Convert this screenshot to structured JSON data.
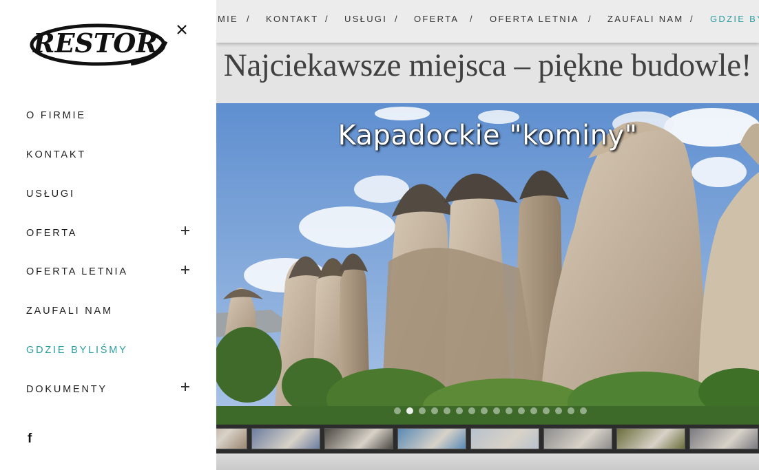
{
  "topnav": {
    "items": [
      "MIE",
      "KONTAKT",
      "USŁUGI",
      "OFERTA",
      "OFERTA LETNIA",
      "ZAUFALI NAM",
      "GDZIE BY"
    ],
    "separator": "/",
    "active_index": 6
  },
  "headline": "Najciekawsze miejsca – piękne budowle!",
  "slider": {
    "caption": "Kapadockie \"kominy\"",
    "dots_total": 16,
    "active_dot": 1
  },
  "thumbnails": [
    {
      "name": "partial",
      "color": "#9a8570"
    },
    {
      "name": "snow-mountains",
      "color": "#6c7da0"
    },
    {
      "name": "crowd",
      "color": "#4d4a44"
    },
    {
      "name": "people-sea",
      "color": "#5a8ab5"
    },
    {
      "name": "snow-people",
      "color": "#b7c1cc"
    },
    {
      "name": "colonnade",
      "color": "#8c8c8c"
    },
    {
      "name": "mural",
      "color": "#6b6e3c"
    },
    {
      "name": "street",
      "color": "#7a7a80"
    }
  ],
  "drawer": {
    "logo_text": "RESTOR",
    "close_icon": "close-icon",
    "items": [
      {
        "label": "O FIRMIE",
        "has_submenu": false,
        "active": false
      },
      {
        "label": "KONTAKT",
        "has_submenu": false,
        "active": false
      },
      {
        "label": "USŁUGI",
        "has_submenu": false,
        "active": false
      },
      {
        "label": "OFERTA",
        "has_submenu": true,
        "active": false
      },
      {
        "label": "OFERTA LETNIA",
        "has_submenu": true,
        "active": false
      },
      {
        "label": "ZAUFALI NAM",
        "has_submenu": false,
        "active": false
      },
      {
        "label": "GDZIE BYLIŚMY",
        "has_submenu": false,
        "active": true
      },
      {
        "label": "DOKUMENTY",
        "has_submenu": true,
        "active": false
      }
    ],
    "social": "f"
  },
  "colors": {
    "accent": "#2a9d9f",
    "text": "#1e1e1e"
  }
}
